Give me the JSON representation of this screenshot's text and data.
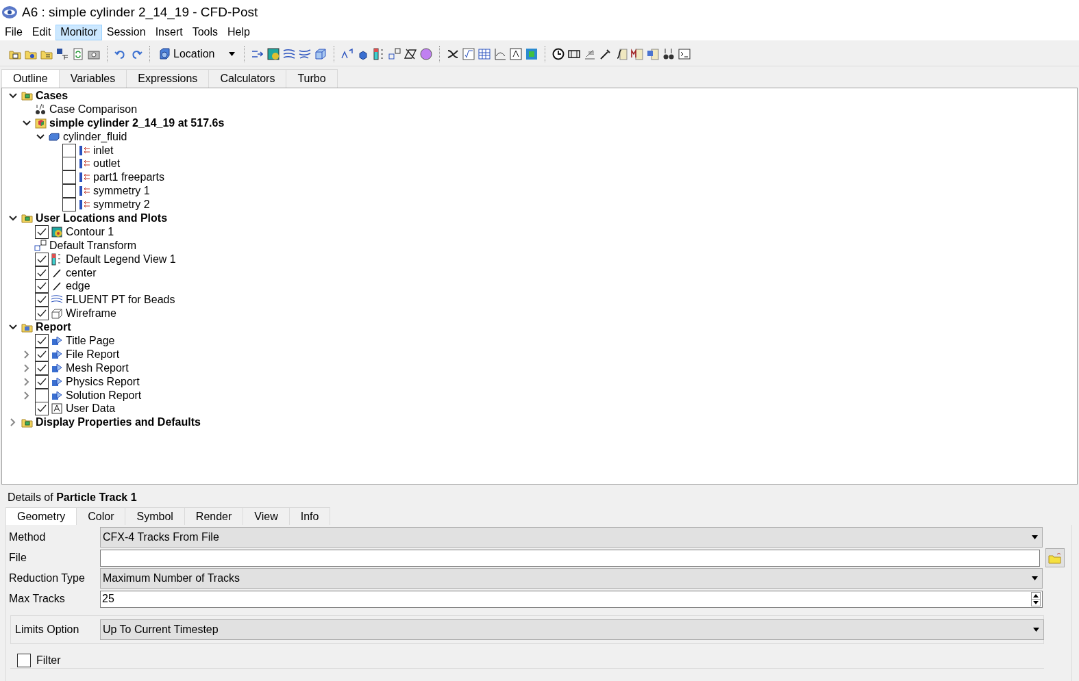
{
  "window": {
    "title": "A6 : simple cylinder 2_14_19 - CFD-Post"
  },
  "menu": [
    {
      "label": "File",
      "selected": false
    },
    {
      "label": "Edit",
      "selected": false
    },
    {
      "label": "Monitor",
      "selected": true
    },
    {
      "label": "Session",
      "selected": false
    },
    {
      "label": "Insert",
      "selected": false
    },
    {
      "label": "Tools",
      "selected": false
    },
    {
      "label": "Help",
      "selected": false
    }
  ],
  "toolbar": {
    "location_button": "Location"
  },
  "tabs": [
    {
      "label": "Outline",
      "selected": true
    },
    {
      "label": "Variables",
      "selected": false
    },
    {
      "label": "Expressions",
      "selected": false
    },
    {
      "label": "Calculators",
      "selected": false
    },
    {
      "label": "Turbo",
      "selected": false
    }
  ],
  "tree": [
    {
      "label": "Cases",
      "kind": "folder",
      "expanded": true,
      "children": [
        {
          "label": "Case Comparison",
          "kind": "compare"
        },
        {
          "label": "simple cylinder 2_14_19 at 517.6s",
          "kind": "case",
          "bold": true,
          "expanded": true,
          "children": [
            {
              "label": "cylinder_fluid",
              "kind": "domain",
              "expanded": true,
              "children": [
                {
                  "label": "inlet",
                  "kind": "boundary",
                  "checked": false
                },
                {
                  "label": "outlet",
                  "kind": "boundary",
                  "checked": false
                },
                {
                  "label": "part1 freeparts",
                  "kind": "boundary",
                  "checked": false
                },
                {
                  "label": "symmetry 1",
                  "kind": "boundary",
                  "checked": false
                },
                {
                  "label": "symmetry 2",
                  "kind": "boundary",
                  "checked": false
                }
              ]
            }
          ]
        }
      ]
    },
    {
      "label": "User Locations and Plots",
      "kind": "folder",
      "expanded": true,
      "children": [
        {
          "label": "Contour 1",
          "kind": "contour",
          "checked": true
        },
        {
          "label": "Default Transform",
          "kind": "transform"
        },
        {
          "label": "Default Legend View 1",
          "kind": "legend",
          "checked": true
        },
        {
          "label": "center",
          "kind": "line",
          "checked": true
        },
        {
          "label": "edge",
          "kind": "line",
          "checked": true
        },
        {
          "label": "FLUENT PT for Beads",
          "kind": "streamline",
          "checked": true
        },
        {
          "label": "Wireframe",
          "kind": "wireframe",
          "checked": true
        }
      ]
    },
    {
      "label": "Report",
      "kind": "report-folder",
      "expanded": true,
      "children": [
        {
          "label": "Title Page",
          "kind": "report",
          "checked": true
        },
        {
          "label": "File Report",
          "kind": "report",
          "checked": true,
          "expanded": false
        },
        {
          "label": "Mesh Report",
          "kind": "report",
          "checked": true,
          "expanded": false
        },
        {
          "label": "Physics Report",
          "kind": "report",
          "checked": true,
          "expanded": false
        },
        {
          "label": "Solution Report",
          "kind": "report",
          "checked": false,
          "expanded": false
        },
        {
          "label": "User Data",
          "kind": "text",
          "checked": true
        }
      ]
    },
    {
      "label": "Display Properties and Defaults",
      "kind": "folder",
      "expanded": false
    }
  ],
  "details": {
    "title": "Details of **Particle Track 1**",
    "tabs": [
      {
        "label": "Geometry",
        "selected": true
      },
      {
        "label": "Color",
        "selected": false
      },
      {
        "label": "Symbol",
        "selected": false
      },
      {
        "label": "Render",
        "selected": false
      },
      {
        "label": "View",
        "selected": false
      },
      {
        "label": "Info",
        "selected": false
      }
    ],
    "fields": [
      {
        "label": "Method",
        "kind": "dropdown",
        "value": "CFX-4 Tracks From File"
      },
      {
        "label": "File",
        "kind": "file"
      },
      {
        "label": "Reduction Type",
        "kind": "dropdown",
        "value": "Maximum Number of Tracks"
      },
      {
        "label": "Max Tracks",
        "kind": "spin",
        "value": "25"
      }
    ],
    "limits": {
      "label": "Limits Option",
      "value": "Up To Current Timestep"
    },
    "filter": {
      "label": "Filter",
      "checked": false
    }
  }
}
